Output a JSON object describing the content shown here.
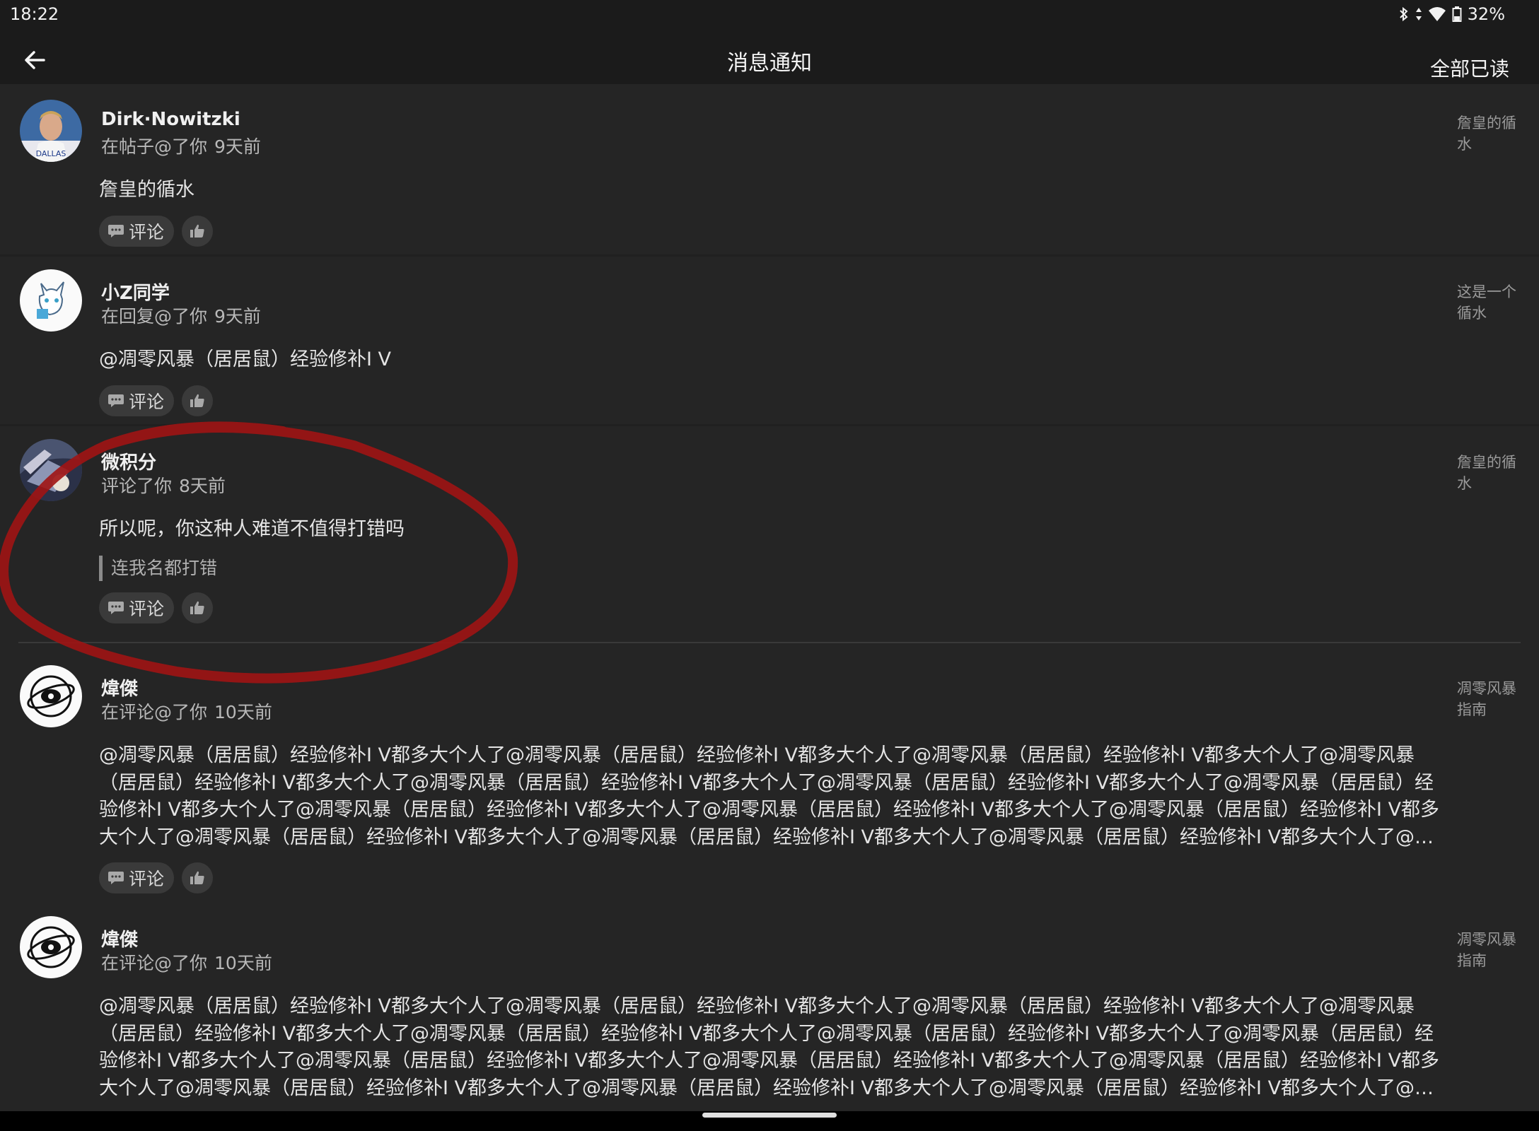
{
  "status_bar": {
    "time": "18:22",
    "battery_text": "32%",
    "icons": [
      "bluetooth-icon",
      "data-arrows-icon",
      "wifi-icon",
      "battery-icon"
    ]
  },
  "app_bar": {
    "title": "消息通知",
    "mark_all_read": "全部已读",
    "back_icon": "arrow-left-icon"
  },
  "colors": {
    "background": "#252525",
    "bar_background": "#1b1b1b",
    "button_background": "#3a3a3a",
    "annotation_red": "#a01414"
  },
  "actions": {
    "comment_label": "评论",
    "comment_icon": "comment-icon",
    "like_icon": "thumbs-up-icon"
  },
  "notifications": [
    {
      "user": "Dirk·Nowitzki",
      "action": "在帖子@了你",
      "time_ago": "9天前",
      "reference": "詹皇的循水",
      "content": "詹皇的循水"
    },
    {
      "user": "小Z同学",
      "action": "在回复@了你",
      "time_ago": "9天前",
      "reference": "这是一个循水",
      "content": "@凋零风暴（居居鼠）经验修补I V"
    },
    {
      "user": "微积分",
      "action": "评论了你",
      "time_ago": "8天前",
      "reference": "詹皇的循水",
      "content": "所以呢，你这种人难道不值得打错吗",
      "quote": "连我名都打错"
    },
    {
      "user": "煒傑",
      "action": "在评论@了你",
      "time_ago": "10天前",
      "reference": "凋零风暴指南",
      "content": "@凋零风暴（居居鼠）经验修补I V都多大个人了@凋零风暴（居居鼠）经验修补I V都多大个人了@凋零风暴（居居鼠）经验修补I V都多大个人了@凋零风暴（居居鼠）经验修补I V都多大个人了@凋零风暴（居居鼠）经验修补I V都多大个人了@凋零风暴（居居鼠）经验修补I V都多大个人了@凋零风暴（居居鼠）经验修补I V都多大个人了@凋零风暴（居居鼠）经验修补I V都多大个人了@凋零风暴（居居鼠）经验修补I V都多大个人了@凋零风暴（居居鼠）经验修补I V都多大个人了@凋零风暴（居居鼠）经验修补I V都多大个人了@凋零风暴（居居鼠）经验修补I V都多大个人了@凋零风暴（居居鼠）经验修补I V都多大个人了@凋零风暴（居居鼠）经验修…"
    },
    {
      "user": "煒傑",
      "action": "在评论@了你",
      "time_ago": "10天前",
      "reference": "凋零风暴指南",
      "content": "@凋零风暴（居居鼠）经验修补I V都多大个人了@凋零风暴（居居鼠）经验修补I V都多大个人了@凋零风暴（居居鼠）经验修补I V都多大个人了@凋零风暴（居居鼠）经验修补I V都多大个人了@凋零风暴（居居鼠）经验修补I V都多大个人了@凋零风暴（居居鼠）经验修补I V都多大个人了@凋零风暴（居居鼠）经验修补I V都多大个人了@凋零风暴（居居鼠）经验修补I V都多大个人了@凋零风暴（居居鼠）经验修补I V都多大个人了@凋零风暴（居居鼠）经验修补I V都多大个人了@凋零风暴（居居鼠）经验修补I V都多大个人了@凋零风暴（居居鼠）经验修补I V都多大个人了@凋零风暴（居居鼠）经验修补I V都多大个人了@凋零风暴（居居鼠）经验修…"
    }
  ]
}
